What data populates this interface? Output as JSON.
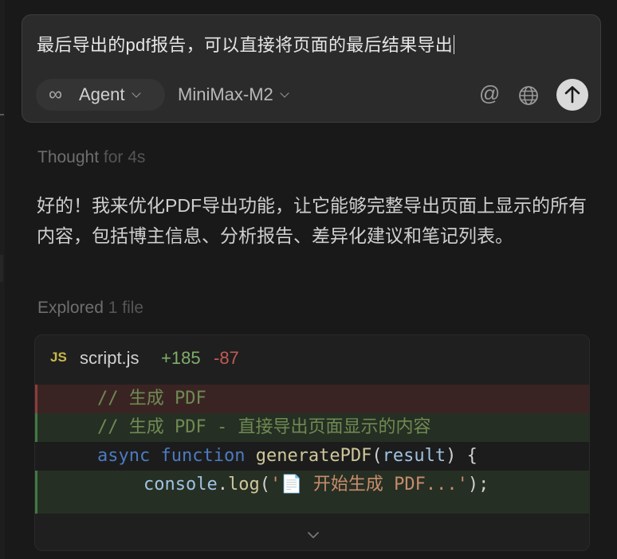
{
  "composer": {
    "input_text": "最后导出的pdf报告，可以直接将页面的最后结果导出",
    "mode_label": "Agent",
    "model_label": "MiniMax-M2",
    "at_symbol": "@"
  },
  "thread": {
    "thought_label": "Thought",
    "thought_duration": "for 4s",
    "message": "好的！我来优化PDF导出功能，让它能够完整导出页面上显示的所有内容，包括博主信息、分析报告、差异化建议和笔记列表。",
    "explored_label": "Explored",
    "explored_count": "1 file"
  },
  "diff": {
    "lang_badge": "JS",
    "file_name": "script.js",
    "additions": "+185",
    "deletions": "-87",
    "lines": {
      "l1": "// 生成 PDF",
      "l2": "// 生成 PDF - 直接导出页面显示的内容",
      "l3_kw1": "async",
      "l3_kw2": "function",
      "l3_fn": "generatePDF",
      "l3_open": "(",
      "l3_param": "result",
      "l3_close": ") {",
      "l4_obj": "console",
      "l4_dot": ".",
      "l4_fn": "log",
      "l4_open": "(",
      "l4_str": "'📄 开始生成 PDF...'",
      "l4_close": ");"
    }
  },
  "colors": {
    "accent_add": "#3f7a44",
    "accent_del": "#8c3d3a",
    "send_button": "#d9d9d9"
  }
}
